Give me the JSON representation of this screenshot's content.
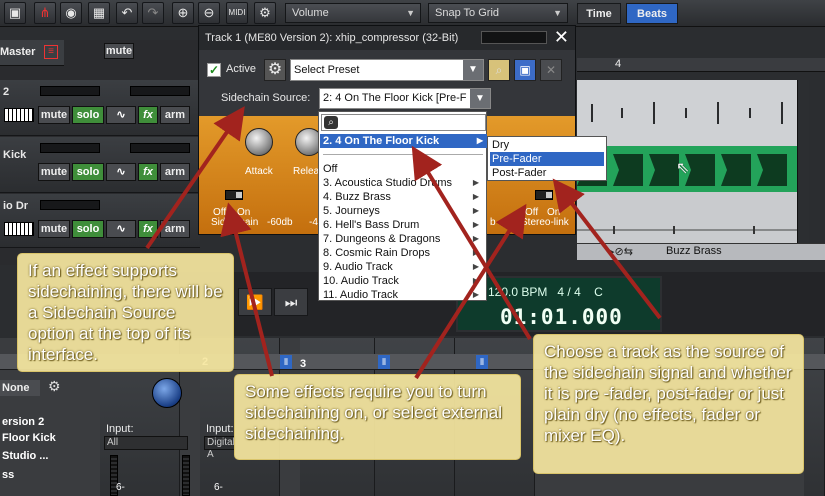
{
  "toolbar": {
    "volume_label": "Volume",
    "snap_label": "Snap To Grid",
    "time_label": "Time",
    "beats_label": "Beats"
  },
  "tracks": {
    "master_label": "Master",
    "items": [
      {
        "name": "2"
      },
      {
        "name": "Kick"
      },
      {
        "name": "io Dr"
      }
    ],
    "mute_label": "mute",
    "solo_label": "solo",
    "fx_label": "fx",
    "arm_label": "arm"
  },
  "plugin": {
    "title": "Track 1 (ME80 Version 2): xhip_compressor (32-Bit)",
    "active_label": "Active",
    "preset_value": "Select Preset",
    "sidechain_label": "Sidechain Source:",
    "sidechain_value": "2: 4 On The Floor Kick [Pre-F",
    "attack_label": "Attack",
    "release_label": "Relea",
    "sidechain_switch": {
      "off": "Off",
      "on": "On",
      "label": "Side-chain"
    },
    "stereo_switch": {
      "off": "Off",
      "on": "On",
      "label": "Stereo-link"
    },
    "db_low": "-60db",
    "db_mid": "-4",
    "b_label": "b"
  },
  "sidechain_list": {
    "selected": "2. 4 On The Floor Kick",
    "items": [
      {
        "label": "Off",
        "sub": false
      },
      {
        "label": "3. Acoustica Studio Drums",
        "sub": true
      },
      {
        "label": "4. Buzz Brass",
        "sub": true
      },
      {
        "label": "5. Journeys",
        "sub": true
      },
      {
        "label": "6. Hell's Bass Drum",
        "sub": true
      },
      {
        "label": "7. Dungeons & Dragons",
        "sub": true
      },
      {
        "label": "8. Cosmic Rain Drops",
        "sub": true
      },
      {
        "label": "9. Audio Track",
        "sub": true
      },
      {
        "label": "10. Audio Track",
        "sub": true
      },
      {
        "label": "11. Audio Track",
        "sub": true
      }
    ]
  },
  "tap_menu": {
    "items": [
      {
        "label": "Dry",
        "active": false
      },
      {
        "label": "Pre-Fader",
        "active": true
      },
      {
        "label": "Post-Fader",
        "active": false
      }
    ]
  },
  "ruler": {
    "mark": "4"
  },
  "arrangement": {
    "clip_label": "Buzz Brass"
  },
  "transport": {
    "bpm": "120.0 BPM",
    "meter": "4 / 4",
    "key": "C",
    "time": "01:01.000"
  },
  "mixer": {
    "strip_numbers": [
      "2",
      "3"
    ],
    "none_label": "None",
    "mute_label": "mute",
    "input_label": "Input:",
    "input_all": "All",
    "input_digital": "Digital A",
    "left_names": [
      "ersion 2",
      "Floor Kick",
      "Studio ...",
      "ss"
    ],
    "db_labels": [
      "6-",
      "6-"
    ]
  },
  "callouts": {
    "c1": "If an effect supports sidechaining, there will be a Sidechain Source option at the top of its interface.",
    "c2": "Some effects require you to turn sidechaining on, or select external sidechaining.",
    "c3": "Choose a track as the source of the sidechain signal and whether it is pre -fader, post-fader or just plain dry (no effects, fader or mixer EQ)."
  },
  "colors": {
    "accent_blue": "#2f67c4",
    "solo_green": "#3f8e3a",
    "compressor_orange": "#d9861c",
    "lcd_green": "#0e3b2c"
  }
}
